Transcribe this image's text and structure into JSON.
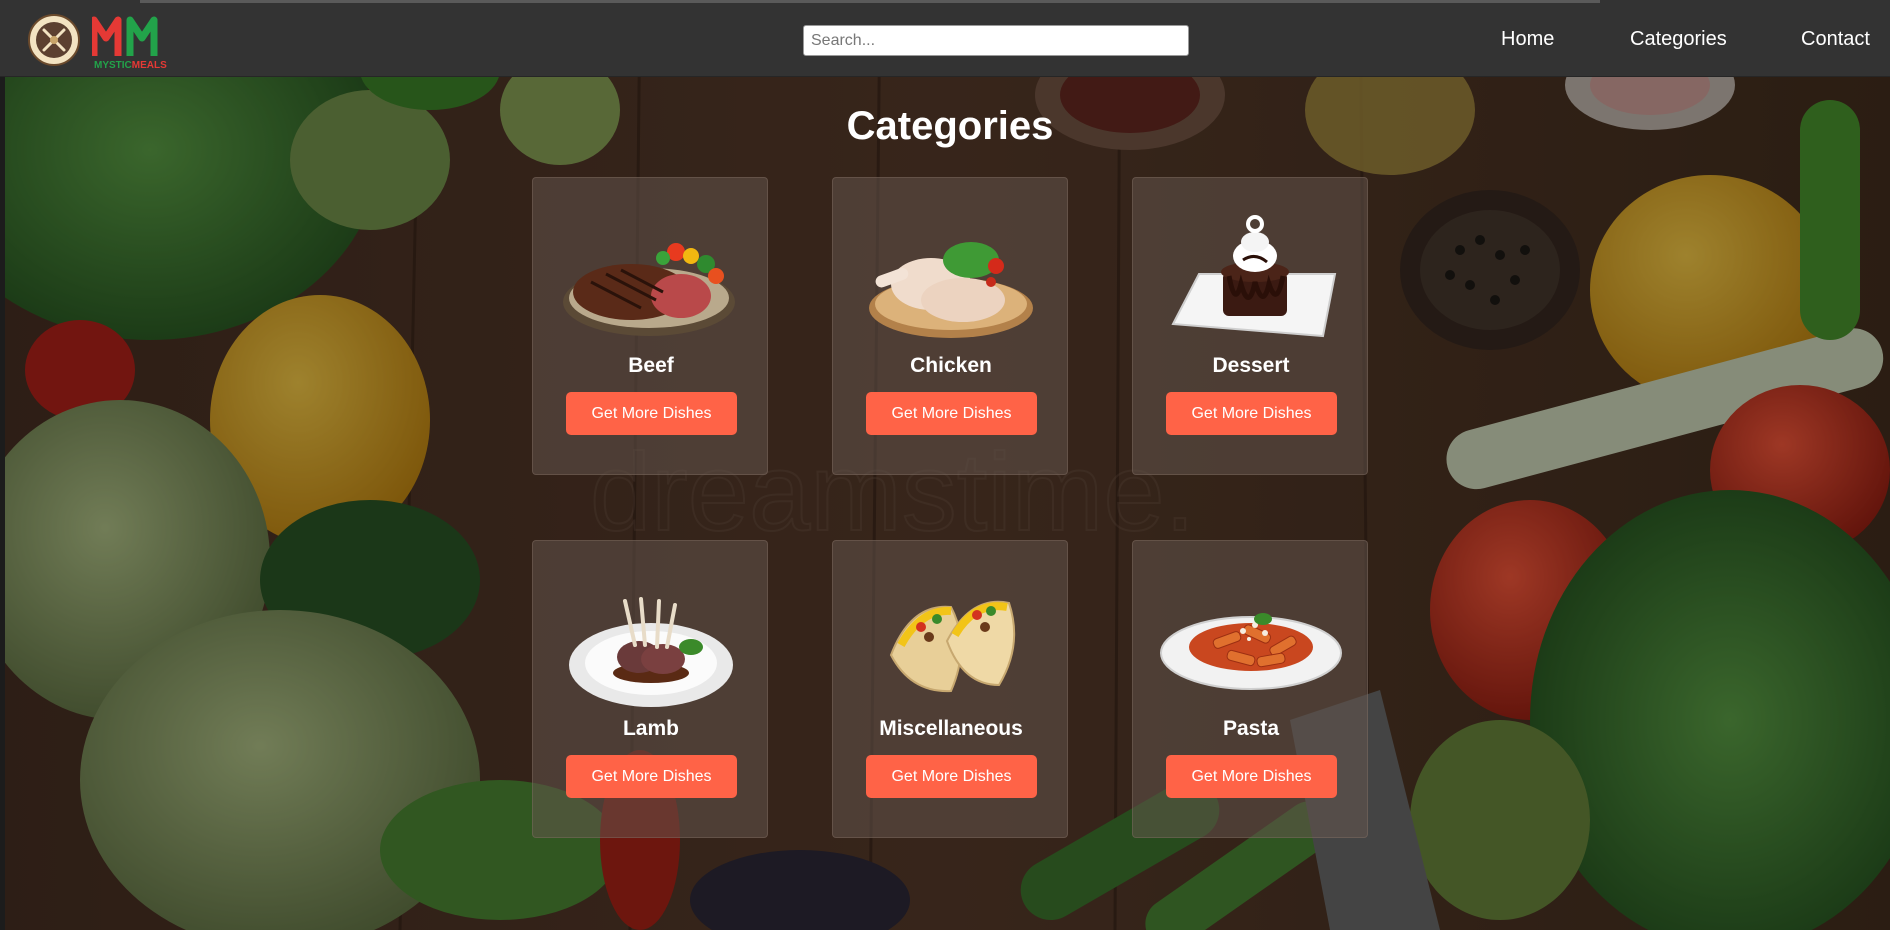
{
  "header": {
    "logo_text_top": "MYSTIC MEALS",
    "logo_monogram": "MM",
    "logo_text_bottom": "MYSTIC MEALS",
    "search_placeholder": "Search...",
    "search_value": "",
    "nav": [
      {
        "label": "Home"
      },
      {
        "label": "Categories"
      },
      {
        "label": "Contact"
      }
    ]
  },
  "main": {
    "title": "Categories",
    "categories": [
      {
        "name": "Beef",
        "button": "Get More Dishes",
        "icon": "steak-plate-image"
      },
      {
        "name": "Chicken",
        "button": "Get More Dishes",
        "icon": "chicken-legs-image"
      },
      {
        "name": "Dessert",
        "button": "Get More Dishes",
        "icon": "chocolate-cake-image"
      },
      {
        "name": "Lamb",
        "button": "Get More Dishes",
        "icon": "lamb-chops-image"
      },
      {
        "name": "Miscellaneous",
        "button": "Get More Dishes",
        "icon": "tacos-image"
      },
      {
        "name": "Pasta",
        "button": "Get More Dishes",
        "icon": "penne-pasta-image"
      }
    ]
  },
  "colors": {
    "navbar": "#333333",
    "button": "#ff6347",
    "logo_red": "#e53935",
    "logo_green": "#22a34a"
  }
}
